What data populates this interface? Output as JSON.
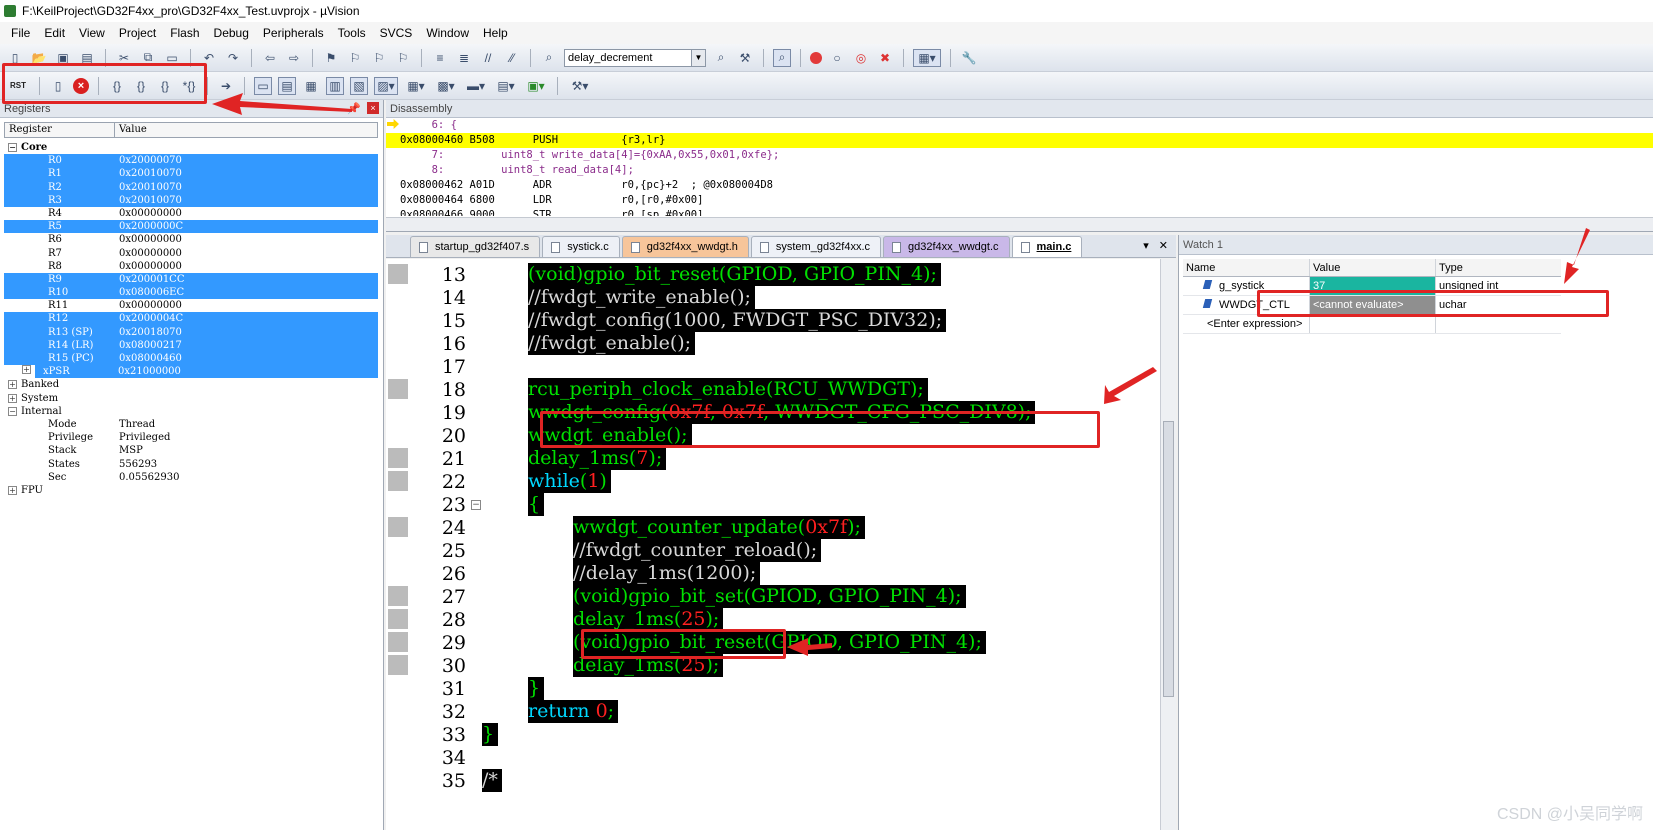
{
  "window": {
    "title": "F:\\KeilProject\\GD32F4xx_pro\\GD32F4xx_Test.uvprojx - µVision"
  },
  "menu": [
    "File",
    "Edit",
    "View",
    "Project",
    "Flash",
    "Debug",
    "Peripherals",
    "Tools",
    "SVCS",
    "Window",
    "Help"
  ],
  "toolbar": {
    "target_combo": "delay_decrement",
    "rst_label": "RST"
  },
  "registers": {
    "caption": "Registers",
    "col_register": "Register",
    "col_value": "Value",
    "core_label": "Core",
    "core": [
      {
        "name": "R0",
        "value": "0x20000070",
        "selected": true
      },
      {
        "name": "R1",
        "value": "0x20010070",
        "selected": true
      },
      {
        "name": "R2",
        "value": "0x20010070",
        "selected": true
      },
      {
        "name": "R3",
        "value": "0x20010070",
        "selected": true
      },
      {
        "name": "R4",
        "value": "0x00000000",
        "selected": false
      },
      {
        "name": "R5",
        "value": "0x2000000C",
        "selected": true
      },
      {
        "name": "R6",
        "value": "0x00000000",
        "selected": false
      },
      {
        "name": "R7",
        "value": "0x00000000",
        "selected": false
      },
      {
        "name": "R8",
        "value": "0x00000000",
        "selected": false
      },
      {
        "name": "R9",
        "value": "0x200001CC",
        "selected": true
      },
      {
        "name": "R10",
        "value": "0x080006EC",
        "selected": true
      },
      {
        "name": "R11",
        "value": "0x00000000",
        "selected": false
      },
      {
        "name": "R12",
        "value": "0x2000004C",
        "selected": true
      },
      {
        "name": "R13 (SP)",
        "value": "0x20018070",
        "selected": true
      },
      {
        "name": "R14 (LR)",
        "value": "0x08000217",
        "selected": true
      },
      {
        "name": "R15 (PC)",
        "value": "0x08000460",
        "selected": true
      },
      {
        "name": "xPSR",
        "value": "0x21000000",
        "selected": true
      }
    ],
    "groups": [
      "Banked",
      "System",
      "Internal"
    ],
    "internal": [
      {
        "name": "Mode",
        "value": "Thread"
      },
      {
        "name": "Privilege",
        "value": "Privileged"
      },
      {
        "name": "Stack",
        "value": "MSP"
      },
      {
        "name": "States",
        "value": "556293"
      },
      {
        "name": "Sec",
        "value": "0.05562930"
      }
    ],
    "fpu_label": "FPU"
  },
  "disassembly": {
    "caption": "Disassembly",
    "lines": [
      {
        "text": "     6: {",
        "kind": "src"
      },
      {
        "text": "0x08000460 B508      PUSH          {r3,lr}",
        "kind": "cur"
      },
      {
        "text": "     7:         uint8_t write_data[4]={0xAA,0x55,0x01,0xfe};",
        "kind": "src"
      },
      {
        "text": "     8:         uint8_t read_data[4];",
        "kind": "src"
      },
      {
        "text": "0x08000462 A01D      ADR           r0,{pc}+2  ; @0x080004D8",
        "kind": "asm"
      },
      {
        "text": "0x08000464 6800      LDR           r0,[r0,#0x00]",
        "kind": "asm"
      },
      {
        "text": "0x08000466 9000      STR           r0,[sp,#0x00]",
        "kind": "asm"
      }
    ]
  },
  "tabs": [
    {
      "label": "startup_gd32f407.s",
      "cls": "t-startup"
    },
    {
      "label": "systick.c",
      "cls": "t-systick"
    },
    {
      "label": "gd32f4xx_wwdgt.h",
      "cls": "t-wwdgt"
    },
    {
      "label": "system_gd32f4xx.c",
      "cls": "t-system"
    },
    {
      "label": "gd32f4xx_wwdgt.c",
      "cls": "t-wwdgtc"
    },
    {
      "label": "main.c",
      "cls": "t-main"
    }
  ],
  "code": [
    {
      "ln": "13",
      "segs": [
        [
          "(void)",
          "c-green"
        ],
        [
          "gpio_bit_reset",
          "c-green"
        ],
        [
          "(GPIOD, ",
          "c-green"
        ],
        [
          "GPIO_PIN_4",
          "c-green"
        ],
        [
          ");",
          "c-green"
        ]
      ],
      "indent": 1
    },
    {
      "ln": "14",
      "segs": [
        [
          "//fwdgt_write_enable();",
          "c-gray"
        ]
      ],
      "indent": 1
    },
    {
      "ln": "15",
      "segs": [
        [
          "//fwdgt_config(1000, FWDGT_PSC_DIV32);",
          "c-gray"
        ]
      ],
      "indent": 1
    },
    {
      "ln": "16",
      "segs": [
        [
          "//fwdgt_enable();",
          "c-gray"
        ]
      ],
      "indent": 1
    },
    {
      "ln": "17",
      "segs": [],
      "indent": 1
    },
    {
      "ln": "18",
      "segs": [
        [
          "rcu_periph_clock_enable(RCU_WWDGT);",
          "c-green"
        ]
      ],
      "indent": 1
    },
    {
      "ln": "19",
      "segs": [
        [
          "wwdgt_config(",
          "c-green"
        ],
        [
          "0x7f",
          "c-red"
        ],
        [
          ", ",
          "c-green"
        ],
        [
          "0x7f",
          "c-red"
        ],
        [
          ", WWDGT_CFG_PSC_DIV8);",
          "c-green"
        ]
      ],
      "indent": 1
    },
    {
      "ln": "20",
      "segs": [
        [
          "wwdgt_enable();",
          "c-green"
        ]
      ],
      "indent": 1
    },
    {
      "ln": "21",
      "segs": [
        [
          "delay_1ms(",
          "c-green"
        ],
        [
          "7",
          "c-red"
        ],
        [
          ");",
          "c-green"
        ]
      ],
      "indent": 1
    },
    {
      "ln": "22",
      "segs": [
        [
          "while",
          "c-cyan"
        ],
        [
          "(",
          "c-green"
        ],
        [
          "1",
          "c-red"
        ],
        [
          ")",
          "c-green"
        ]
      ],
      "indent": 1
    },
    {
      "ln": "23",
      "segs": [
        [
          "{",
          "c-green"
        ]
      ],
      "indent": 1
    },
    {
      "ln": "24",
      "segs": [
        [
          "wwdgt_counter_update(",
          "c-green"
        ],
        [
          "0x7f",
          "c-red"
        ],
        [
          ");",
          "c-green"
        ]
      ],
      "indent": 2
    },
    {
      "ln": "25",
      "segs": [
        [
          "//fwdgt_counter_reload();",
          "c-gray"
        ]
      ],
      "indent": 2
    },
    {
      "ln": "26",
      "segs": [
        [
          "//delay_1ms(1200);",
          "c-gray"
        ]
      ],
      "indent": 2
    },
    {
      "ln": "27",
      "segs": [
        [
          "(void)gpio_bit_set(GPIOD, GPIO_PIN_4);",
          "c-green"
        ]
      ],
      "indent": 2
    },
    {
      "ln": "28",
      "segs": [
        [
          "delay_1ms(",
          "c-green"
        ],
        [
          "25",
          "c-red"
        ],
        [
          ");",
          "c-green"
        ]
      ],
      "indent": 2
    },
    {
      "ln": "29",
      "segs": [
        [
          "(void)gpio_bit_reset(GPIOD, GPIO_PIN_4);",
          "c-green"
        ]
      ],
      "indent": 2
    },
    {
      "ln": "30",
      "segs": [
        [
          "delay_1ms(",
          "c-green"
        ],
        [
          "25",
          "c-red"
        ],
        [
          ");",
          "c-green"
        ]
      ],
      "indent": 2
    },
    {
      "ln": "31",
      "segs": [
        [
          "}",
          "c-green"
        ]
      ],
      "indent": 1
    },
    {
      "ln": "32",
      "segs": [
        [
          "return ",
          "c-cyan"
        ],
        [
          "0",
          "c-red"
        ],
        [
          ";",
          "c-green"
        ]
      ],
      "indent": 1
    },
    {
      "ln": "33",
      "segs": [
        [
          "}",
          "c-green"
        ]
      ],
      "indent": 0
    },
    {
      "ln": "34",
      "segs": [],
      "indent": 0
    },
    {
      "ln": "35",
      "segs": [
        [
          "/*",
          "c-gray"
        ]
      ],
      "indent": 0
    }
  ],
  "watch": {
    "caption": "Watch 1",
    "col_name": "Name",
    "col_value": "Value",
    "col_type": "Type",
    "rows": [
      {
        "name": "g_systick",
        "value": "37",
        "type": "unsigned int",
        "vstyle": "val-teal"
      },
      {
        "name": "WWDGT_CTL",
        "value": "<cannot evaluate>",
        "type": "uchar",
        "vstyle": "val-gray"
      }
    ],
    "enter_expression": "<Enter expression>"
  },
  "watermark": "CSDN @小吴同学啊"
}
